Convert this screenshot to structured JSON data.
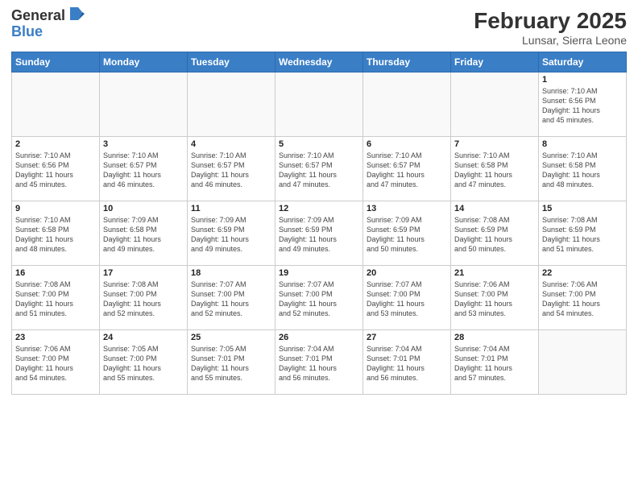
{
  "header": {
    "logo_general": "General",
    "logo_blue": "Blue",
    "month_title": "February 2025",
    "location": "Lunsar, Sierra Leone"
  },
  "weekdays": [
    "Sunday",
    "Monday",
    "Tuesday",
    "Wednesday",
    "Thursday",
    "Friday",
    "Saturday"
  ],
  "weeks": [
    [
      {
        "day": "",
        "info": ""
      },
      {
        "day": "",
        "info": ""
      },
      {
        "day": "",
        "info": ""
      },
      {
        "day": "",
        "info": ""
      },
      {
        "day": "",
        "info": ""
      },
      {
        "day": "",
        "info": ""
      },
      {
        "day": "1",
        "info": "Sunrise: 7:10 AM\nSunset: 6:56 PM\nDaylight: 11 hours\nand 45 minutes."
      }
    ],
    [
      {
        "day": "2",
        "info": "Sunrise: 7:10 AM\nSunset: 6:56 PM\nDaylight: 11 hours\nand 45 minutes."
      },
      {
        "day": "3",
        "info": "Sunrise: 7:10 AM\nSunset: 6:57 PM\nDaylight: 11 hours\nand 46 minutes."
      },
      {
        "day": "4",
        "info": "Sunrise: 7:10 AM\nSunset: 6:57 PM\nDaylight: 11 hours\nand 46 minutes."
      },
      {
        "day": "5",
        "info": "Sunrise: 7:10 AM\nSunset: 6:57 PM\nDaylight: 11 hours\nand 47 minutes."
      },
      {
        "day": "6",
        "info": "Sunrise: 7:10 AM\nSunset: 6:57 PM\nDaylight: 11 hours\nand 47 minutes."
      },
      {
        "day": "7",
        "info": "Sunrise: 7:10 AM\nSunset: 6:58 PM\nDaylight: 11 hours\nand 47 minutes."
      },
      {
        "day": "8",
        "info": "Sunrise: 7:10 AM\nSunset: 6:58 PM\nDaylight: 11 hours\nand 48 minutes."
      }
    ],
    [
      {
        "day": "9",
        "info": "Sunrise: 7:10 AM\nSunset: 6:58 PM\nDaylight: 11 hours\nand 48 minutes."
      },
      {
        "day": "10",
        "info": "Sunrise: 7:09 AM\nSunset: 6:58 PM\nDaylight: 11 hours\nand 49 minutes."
      },
      {
        "day": "11",
        "info": "Sunrise: 7:09 AM\nSunset: 6:59 PM\nDaylight: 11 hours\nand 49 minutes."
      },
      {
        "day": "12",
        "info": "Sunrise: 7:09 AM\nSunset: 6:59 PM\nDaylight: 11 hours\nand 49 minutes."
      },
      {
        "day": "13",
        "info": "Sunrise: 7:09 AM\nSunset: 6:59 PM\nDaylight: 11 hours\nand 50 minutes."
      },
      {
        "day": "14",
        "info": "Sunrise: 7:08 AM\nSunset: 6:59 PM\nDaylight: 11 hours\nand 50 minutes."
      },
      {
        "day": "15",
        "info": "Sunrise: 7:08 AM\nSunset: 6:59 PM\nDaylight: 11 hours\nand 51 minutes."
      }
    ],
    [
      {
        "day": "16",
        "info": "Sunrise: 7:08 AM\nSunset: 7:00 PM\nDaylight: 11 hours\nand 51 minutes."
      },
      {
        "day": "17",
        "info": "Sunrise: 7:08 AM\nSunset: 7:00 PM\nDaylight: 11 hours\nand 52 minutes."
      },
      {
        "day": "18",
        "info": "Sunrise: 7:07 AM\nSunset: 7:00 PM\nDaylight: 11 hours\nand 52 minutes."
      },
      {
        "day": "19",
        "info": "Sunrise: 7:07 AM\nSunset: 7:00 PM\nDaylight: 11 hours\nand 52 minutes."
      },
      {
        "day": "20",
        "info": "Sunrise: 7:07 AM\nSunset: 7:00 PM\nDaylight: 11 hours\nand 53 minutes."
      },
      {
        "day": "21",
        "info": "Sunrise: 7:06 AM\nSunset: 7:00 PM\nDaylight: 11 hours\nand 53 minutes."
      },
      {
        "day": "22",
        "info": "Sunrise: 7:06 AM\nSunset: 7:00 PM\nDaylight: 11 hours\nand 54 minutes."
      }
    ],
    [
      {
        "day": "23",
        "info": "Sunrise: 7:06 AM\nSunset: 7:00 PM\nDaylight: 11 hours\nand 54 minutes."
      },
      {
        "day": "24",
        "info": "Sunrise: 7:05 AM\nSunset: 7:00 PM\nDaylight: 11 hours\nand 55 minutes."
      },
      {
        "day": "25",
        "info": "Sunrise: 7:05 AM\nSunset: 7:01 PM\nDaylight: 11 hours\nand 55 minutes."
      },
      {
        "day": "26",
        "info": "Sunrise: 7:04 AM\nSunset: 7:01 PM\nDaylight: 11 hours\nand 56 minutes."
      },
      {
        "day": "27",
        "info": "Sunrise: 7:04 AM\nSunset: 7:01 PM\nDaylight: 11 hours\nand 56 minutes."
      },
      {
        "day": "28",
        "info": "Sunrise: 7:04 AM\nSunset: 7:01 PM\nDaylight: 11 hours\nand 57 minutes."
      },
      {
        "day": "",
        "info": ""
      }
    ]
  ]
}
